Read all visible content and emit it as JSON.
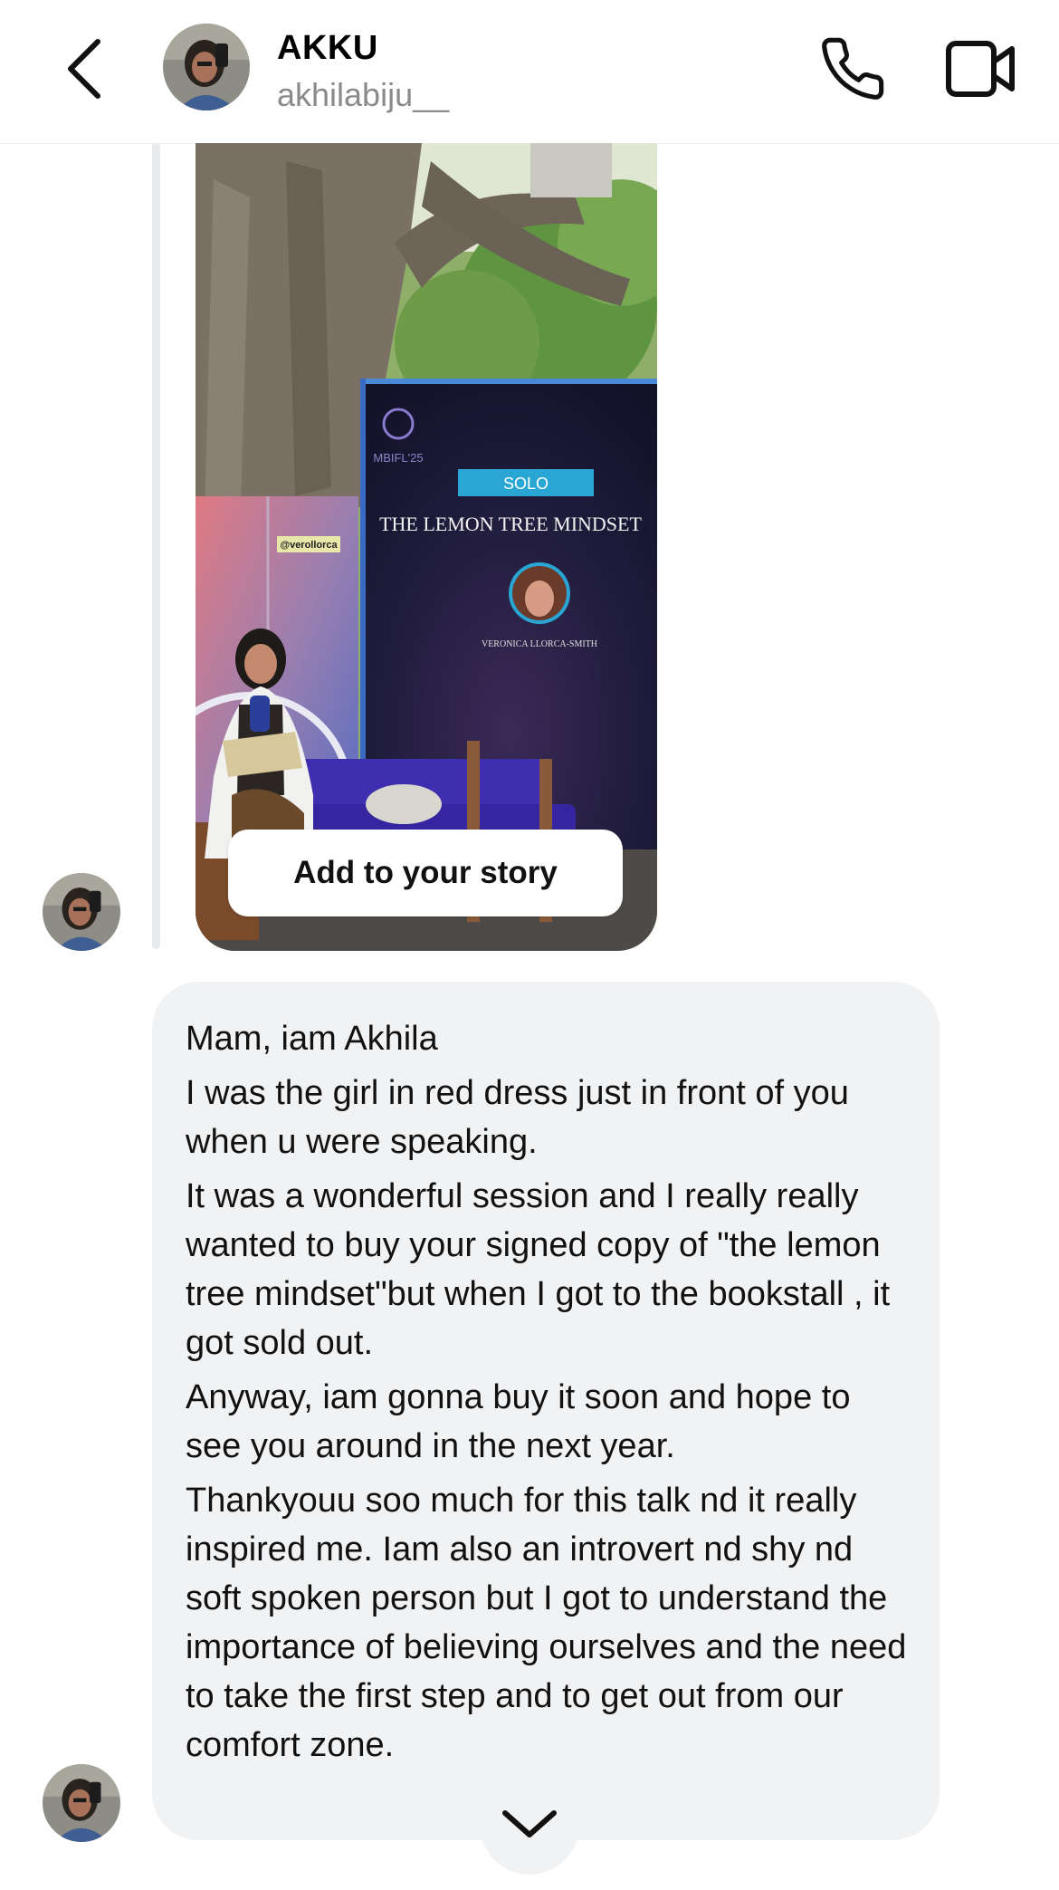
{
  "header": {
    "name": "AKKU",
    "handle": "akhilabiju__",
    "icons": [
      "back-chevron-icon",
      "phone-icon",
      "video-camera-icon"
    ]
  },
  "story": {
    "screen": {
      "logo": "MBIFL'25",
      "tag": "SOLO",
      "title": "THE LEMON TREE MINDSET",
      "speaker": "VERONICA LLORCA-SMITH"
    },
    "name_card": "@verollorca",
    "add_button": "Add to your story"
  },
  "message": {
    "paragraphs": [
      "Mam, iam Akhila",
      "I was the girl in red dress just in front of you when u were speaking.",
      "It was a wonderful session and I really really wanted to buy your signed copy of \"the lemon tree mindset\"but when I got to the bookstall , it got sold out.",
      "Anyway, iam gonna buy it soon and hope to see you around in the next year.",
      "Thankyouu soo much for this talk nd it really inspired me. Iam also an introvert nd shy nd soft spoken person but I got to understand the importance of believing ourselves and the need to take the first step and to get out from our comfort zone."
    ]
  },
  "colors": {
    "bubble": "#f1f2f4",
    "thread_line": "#e9eaee",
    "handle": "#8a8a8a"
  }
}
